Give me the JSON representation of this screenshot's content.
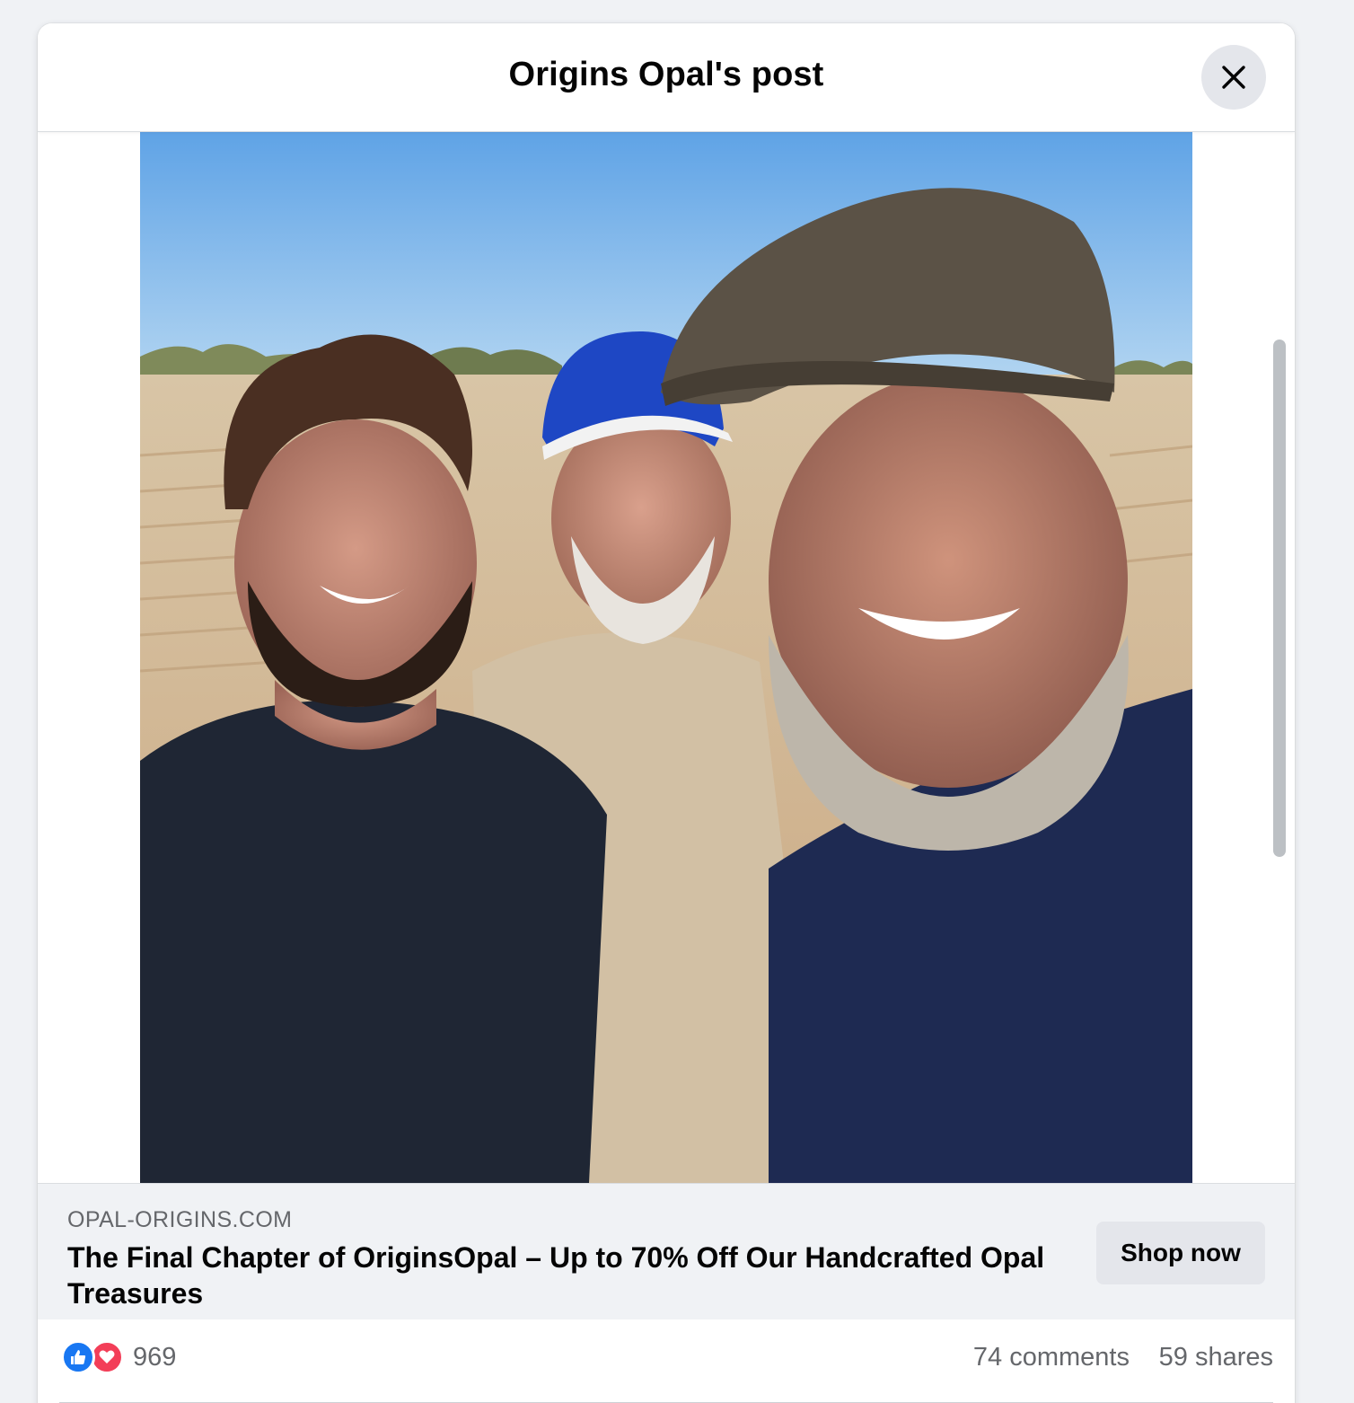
{
  "dialog": {
    "title": "Origins Opal's post",
    "close_icon": "close-icon"
  },
  "post": {
    "image_alt": "Three smiling men in dusty t-shirts and caps standing in an outback opal field",
    "link_preview": {
      "domain": "OPAL-ORIGINS.COM",
      "headline": "The Final Chapter of OriginsOpal – Up to 70% Off Our Handcrafted Opal Treasures",
      "cta_label": "Shop now"
    },
    "stats": {
      "reaction_icons": [
        "like-icon",
        "love-icon"
      ],
      "reaction_count": "969",
      "comments": "74 comments",
      "shares": "59 shares"
    }
  },
  "colors": {
    "background": "#f0f2f5",
    "like_blue": "#1877f2",
    "love_red": "#f33e58",
    "secondary_text": "#65676b",
    "button_gray": "#e4e6eb"
  }
}
